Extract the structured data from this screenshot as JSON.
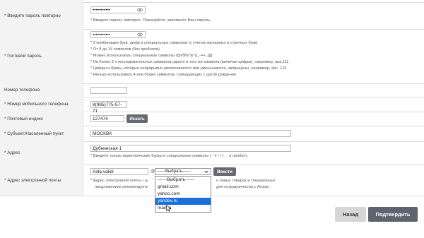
{
  "rows": {
    "password_repeat": {
      "label": "* Введите пароль повторно",
      "value": "•••••••••••",
      "note": "* Введите пароль повторно. Пожалуйста, запомните Ваш пароль."
    },
    "guest_password": {
      "label": "* Гостевой пароль",
      "value": "•••••••••••",
      "notes": [
        "* 3 комбинации букв, цифр и специальных символов (с учетом заглавных и строчных букв)",
        "* От 8 до 14 символов (без пробелов)",
        "* Можно использовать специальные символы !@#$%^&*()_-=+,.[]{}",
        "* Не более 3-х последовательных символов одного и того же символа (включая цифры), например, aaa,111",
        "* Цифры и буквы, которые непрерывно увеличиваются или уменьшаются, запрещены, например, abc, 123",
        "* Нельзя использовать 4 или более символов, совпадающих с датой рождения"
      ]
    },
    "phone": {
      "label": "Номер телефона",
      "value": ""
    },
    "mobile": {
      "label": "* Номер мобильного телефона",
      "value": "8(985)775-57-71"
    },
    "postal": {
      "label": "* Почтовый индекс",
      "value": "127474",
      "button": "Искать"
    },
    "city": {
      "label": "* Субъект/Населенный пункт",
      "value": "МОСКВА"
    },
    "address": {
      "label": "* Адрес",
      "value": "Дубнинская 1",
      "note": "* Введите только кириллические буквы и специальные символы ( - # / ( ) ,  . и пробел)."
    },
    "email": {
      "label": "* Адрес электронной почты",
      "value": "Aida.validi",
      "at": "@",
      "select_value": "------Выбрать------",
      "button": "Ввести",
      "note_line1": "* Адрес электронной почты – д",
      "note_line1_right": "о новых товарах и специальных",
      "note_line2": "предложениях рекомендуетс",
      "note_line2_right": "для сотрудничества с Атоми."
    }
  },
  "dropdown": {
    "options": [
      "------Выбрать------",
      "gmail.com",
      "yahoo.com",
      "yandex.ru",
      "mail.ru"
    ],
    "selected_index": 3
  },
  "footer": {
    "back_label": "Назад",
    "confirm_label": "Подтвердить"
  },
  "colors": {
    "label_bg": "#f3f3f3",
    "dark_button": "#686a72",
    "dropdown_highlight": "#1a6fd9",
    "confirm_bg": "#5e646f",
    "back_bg": "#d6d6d6"
  }
}
